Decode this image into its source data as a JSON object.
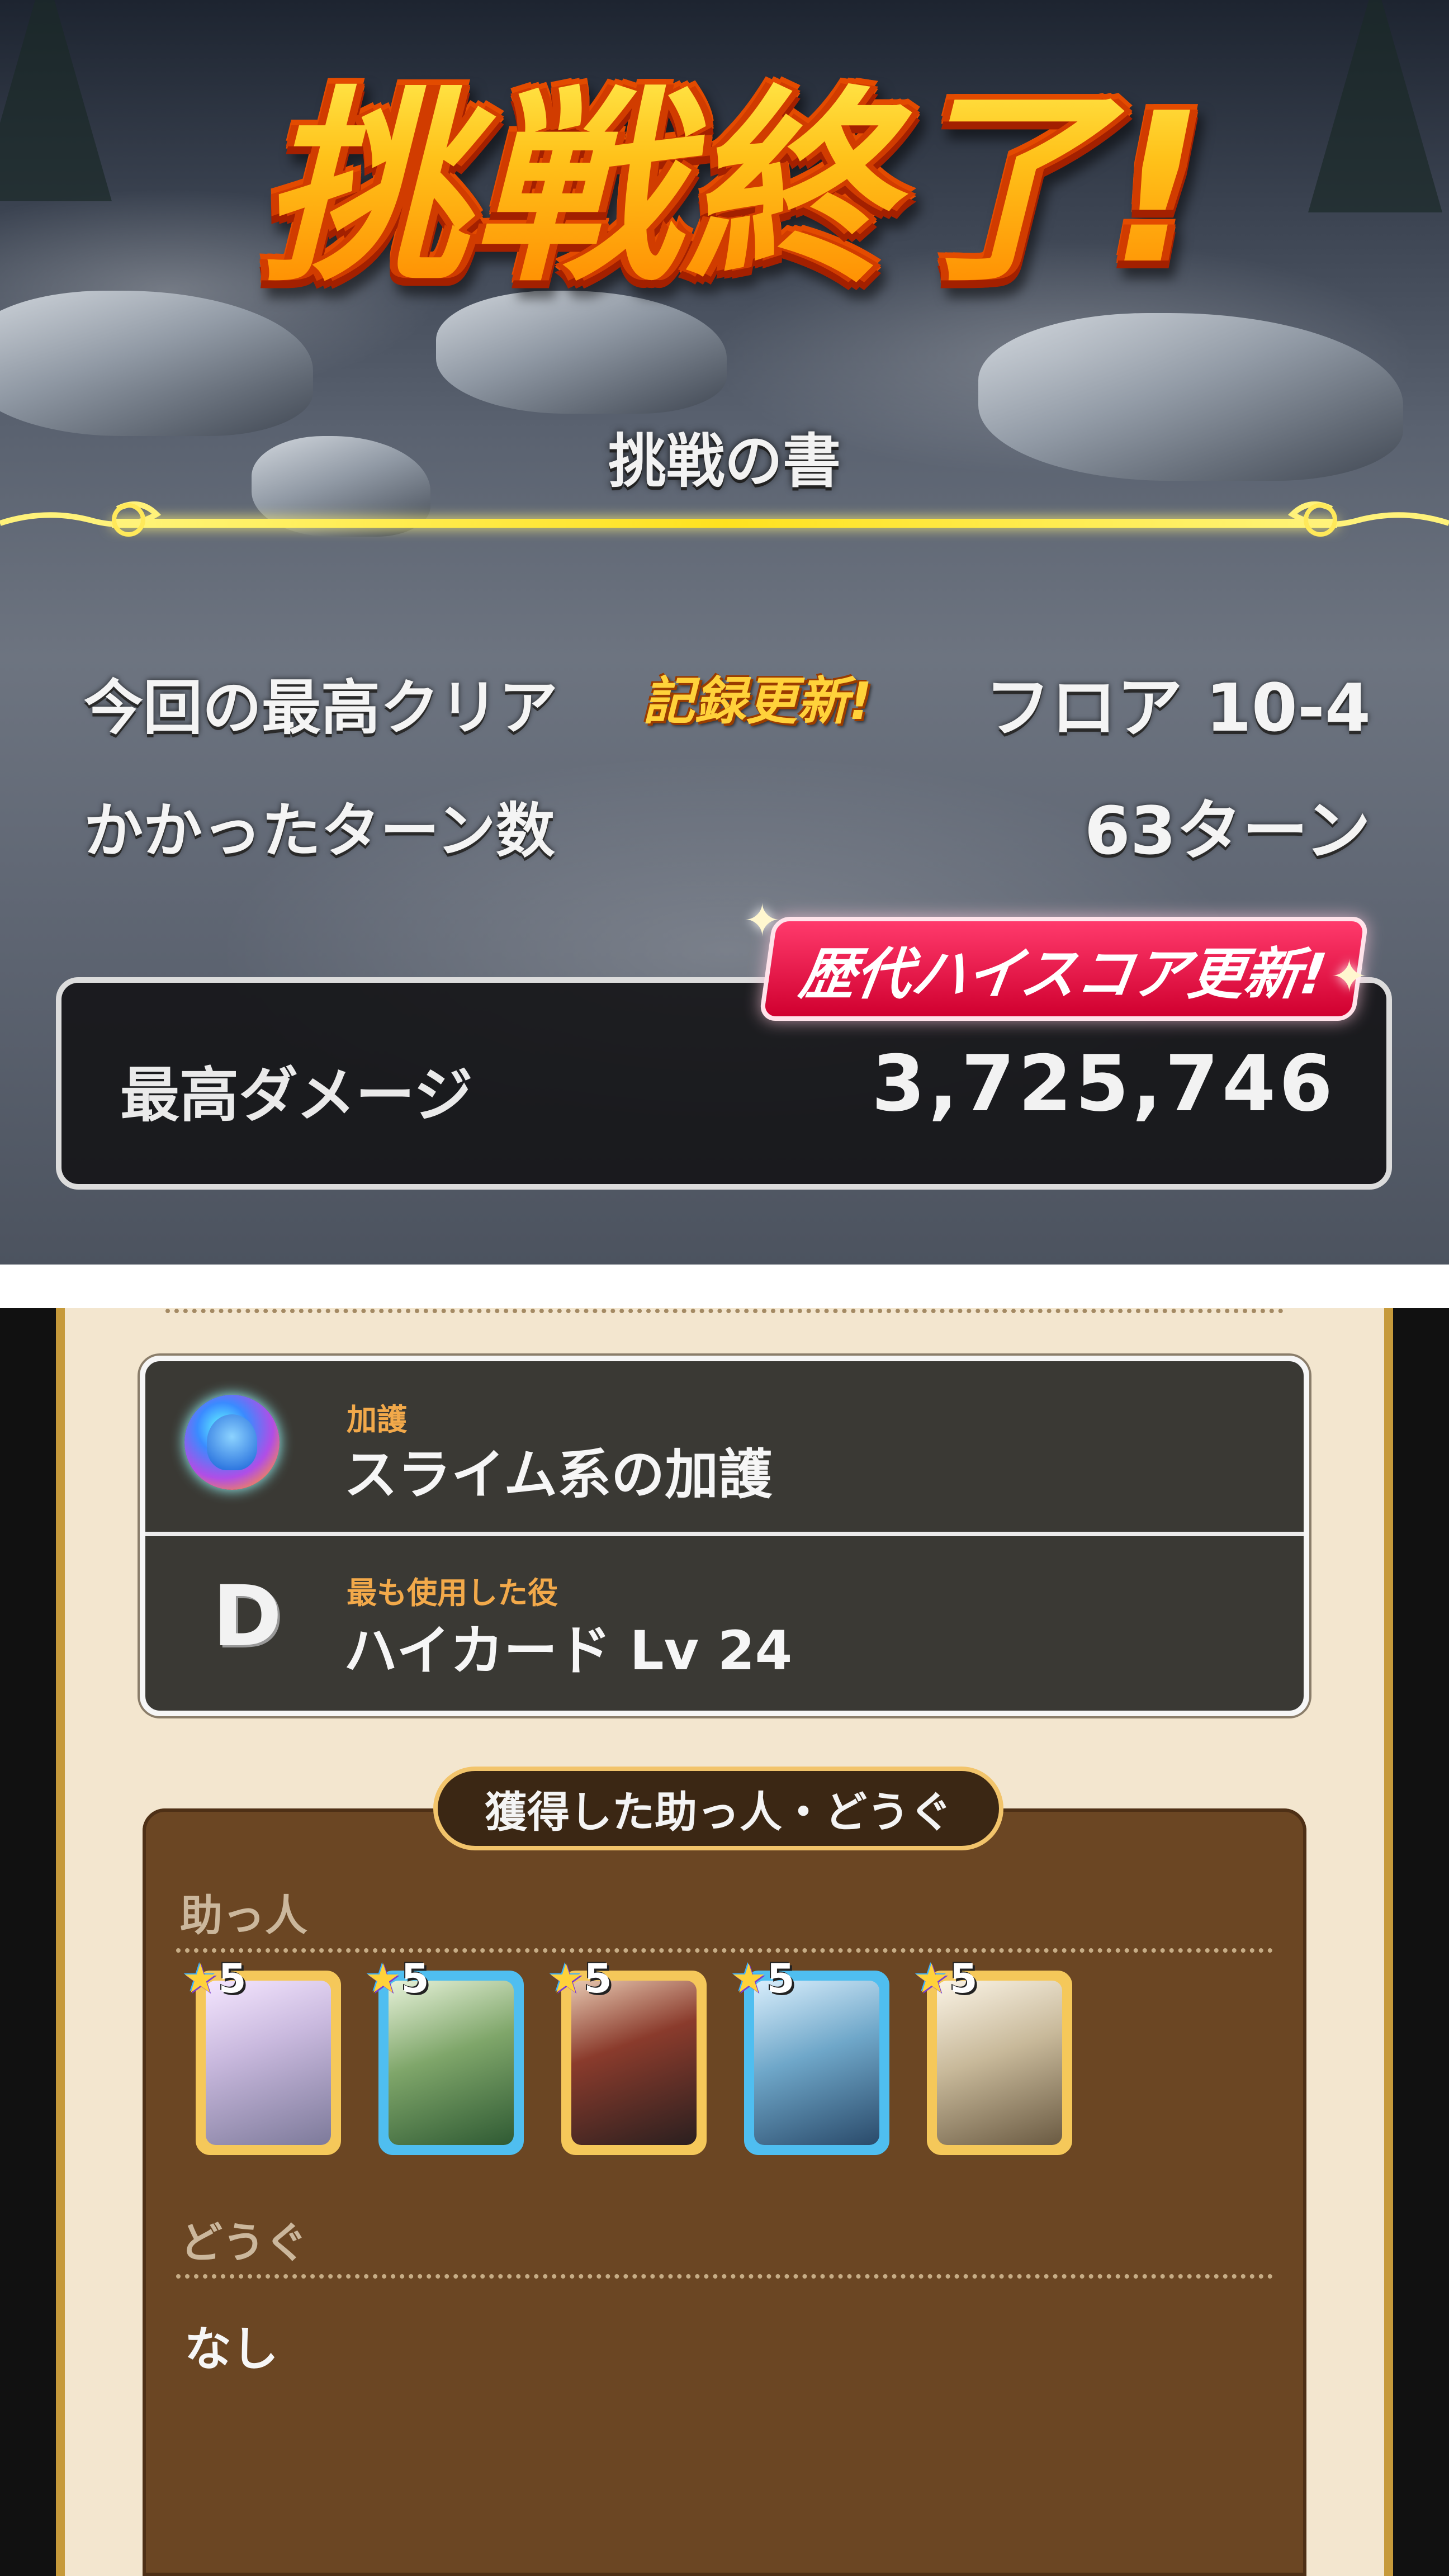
{
  "result": {
    "title": "挑戦終了!",
    "book_name": "挑戦の書",
    "best_clear_label": "今回の最高クリア",
    "record_badge": "記録更新!",
    "best_clear_value": "フロア 10-4",
    "turns_label": "かかったターン数",
    "turns_value": "63ターン",
    "hiscore_badge": "歴代ハイスコア更新!",
    "max_damage_label": "最高ダメージ",
    "max_damage_value": "3,725,746"
  },
  "details": {
    "blessing_tag": "加護",
    "blessing_value": "スライム系の加護",
    "hand_tag": "最も使用した役",
    "hand_rank": "D",
    "hand_value": "ハイカード Lv 24",
    "obtained_header": "獲得した助っ人・どうぐ",
    "helpers_label": "助っ人",
    "helpers": [
      {
        "stars": "5",
        "icon": "white-armored-knight-portrait",
        "frame": "#f5c85a"
      },
      {
        "stars": "5",
        "icon": "bearded-sage-portrait",
        "frame": "#4fbef0"
      },
      {
        "stars": "5",
        "icon": "red-haired-warrior-portrait",
        "frame": "#f5c85a"
      },
      {
        "stars": "5",
        "icon": "blue-haired-dancer-portrait",
        "frame": "#4fbef0"
      },
      {
        "stars": "5",
        "icon": "white-hat-mage-portrait",
        "frame": "#f5c85a"
      }
    ],
    "items_label": "どうぐ",
    "items_value": "なし"
  }
}
